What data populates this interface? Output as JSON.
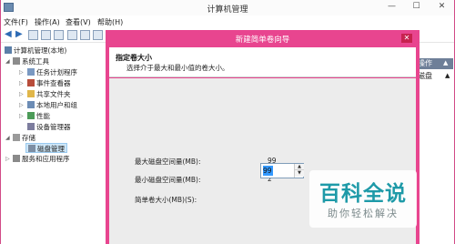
{
  "window": {
    "title": "计算机管理"
  },
  "menu": [
    "文件(F)",
    "操作(A)",
    "查看(V)",
    "帮助(H)"
  ],
  "tree": {
    "root": "计算机管理(本地)",
    "system_tools": "系统工具",
    "task_scheduler": "任务计划程序",
    "event_viewer": "事件查看器",
    "shared_folders": "共享文件夹",
    "local_users": "本地用户和组",
    "performance": "性能",
    "device_manager": "设备管理器",
    "storage": "存储",
    "disk_management": "磁盘管理",
    "services": "服务和应用程序"
  },
  "actions": {
    "header": "操作",
    "item": "磁盘"
  },
  "wizard": {
    "title": "新建简单卷向导",
    "heading": "指定卷大小",
    "subheading": "选择介于最大和最小值的卷大小。",
    "max_label": "最大磁盘空间量(MB):",
    "max_value": "99",
    "min_label": "最小磁盘空间量(MB):",
    "min_value": "2",
    "size_label": "简单卷大小(MB)(S):",
    "size_value": "99"
  },
  "watermark": {
    "main": "百科全说",
    "sub": "助你轻松解决"
  }
}
